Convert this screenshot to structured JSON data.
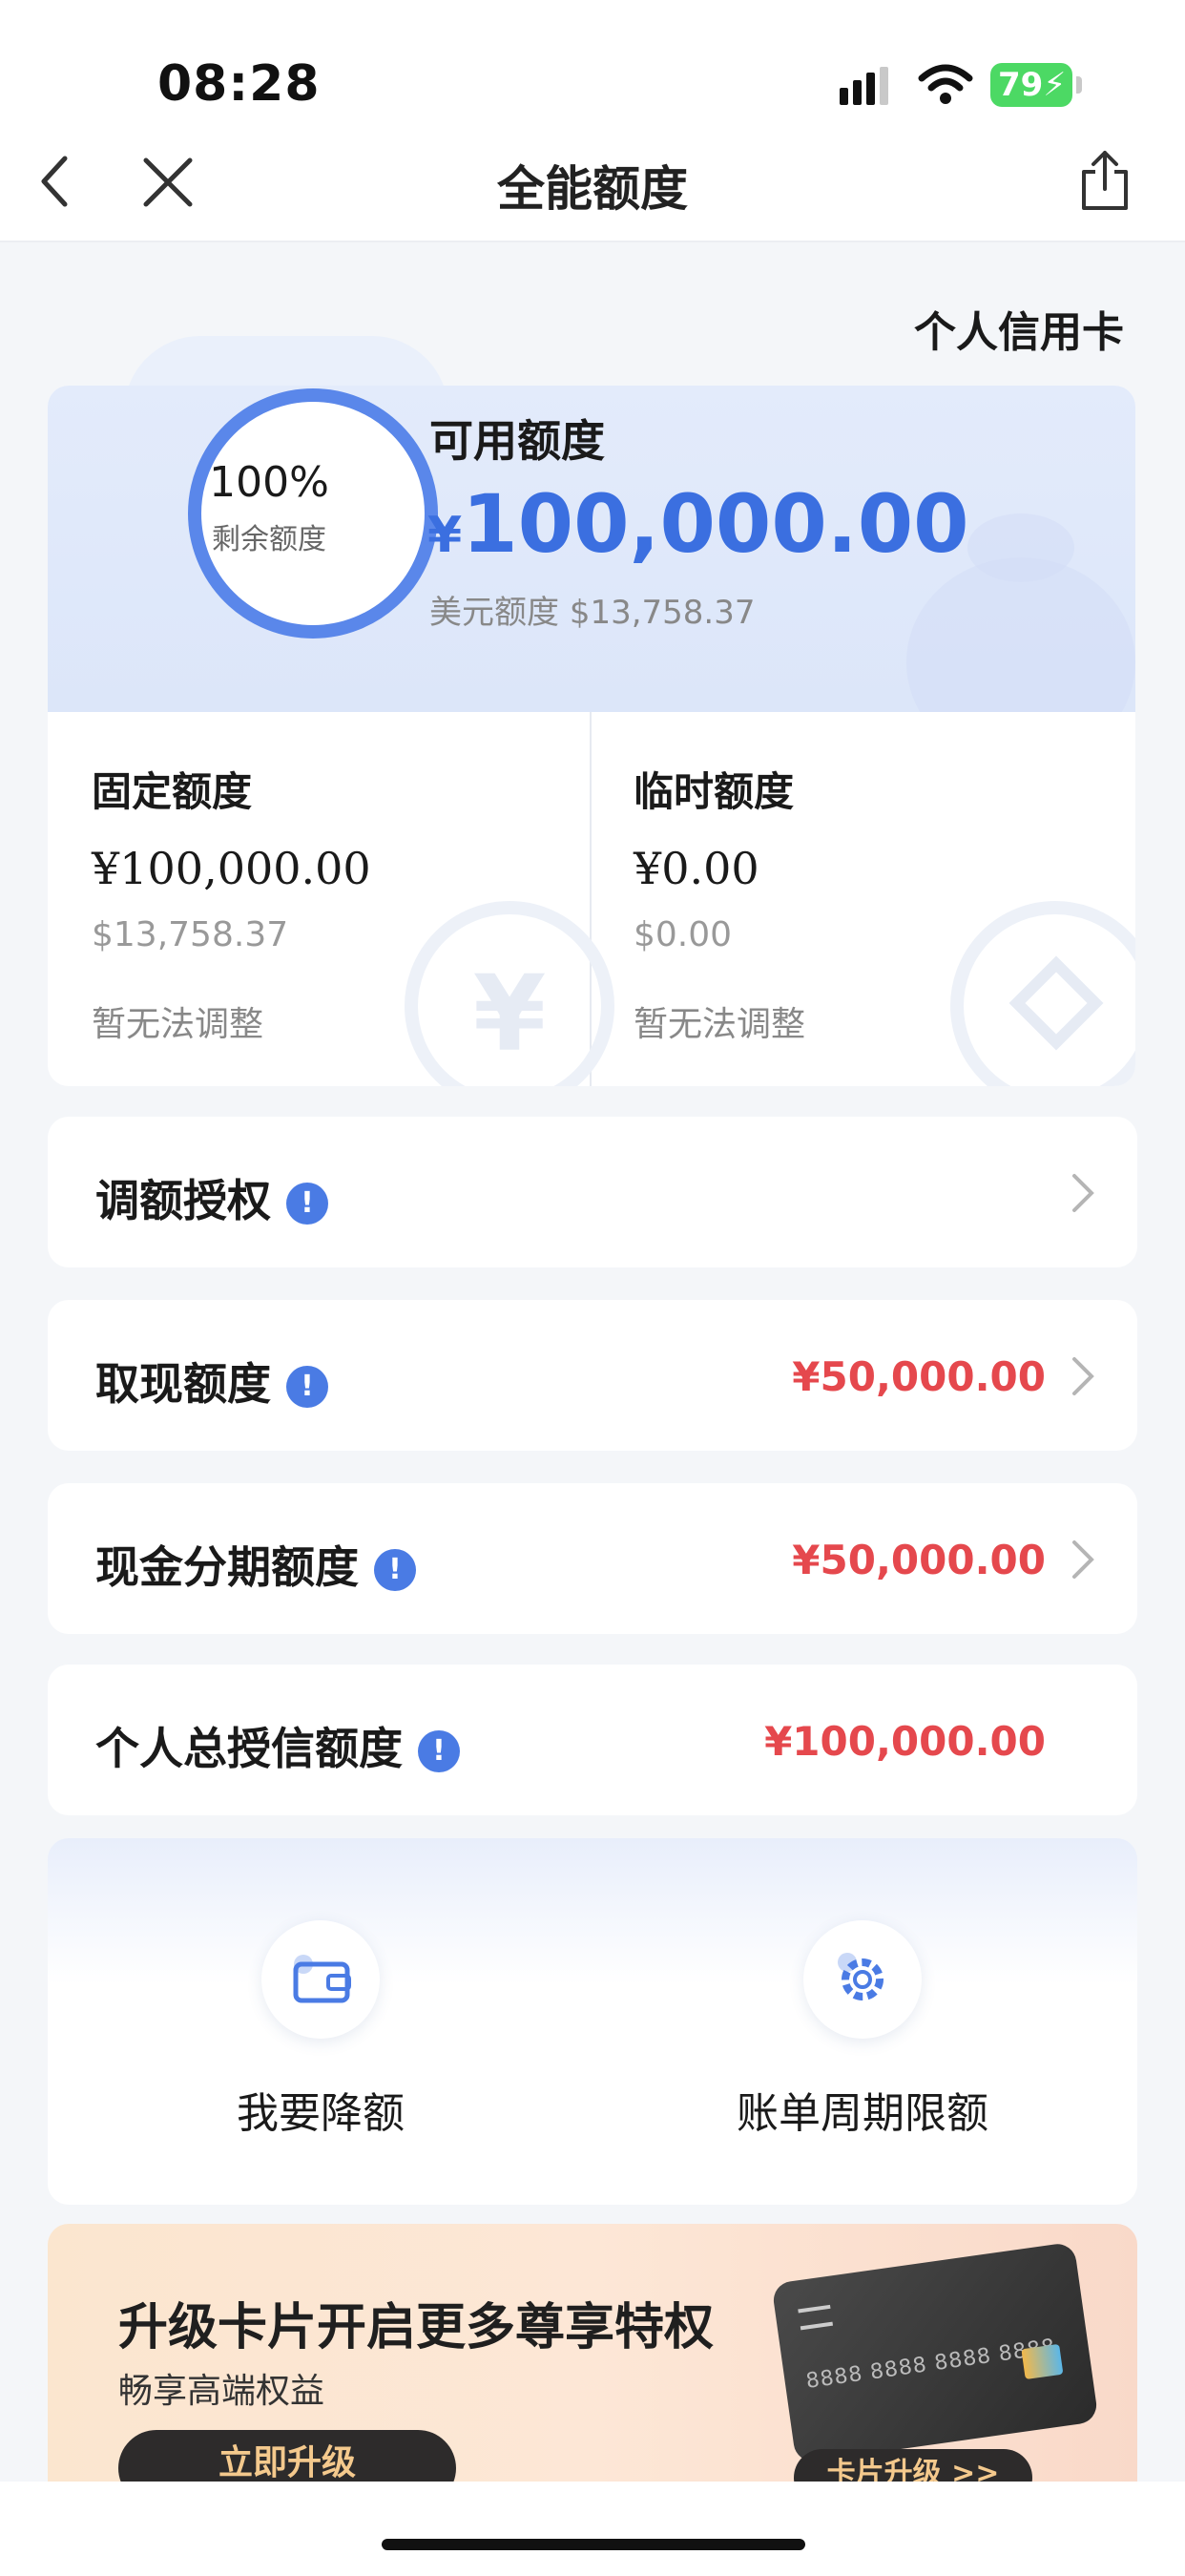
{
  "status_bar": {
    "time": "08:28",
    "battery": "79"
  },
  "nav": {
    "title": "全能额度"
  },
  "card_type": "个人信用卡",
  "quota": {
    "ring_percent": "100%",
    "ring_percent_value": 100,
    "ring_sub": "剩余额度",
    "available_label": "可用额度",
    "available_currency": "¥",
    "available_amount": "100,000.00",
    "usd_label": "美元额度",
    "usd_amount": "$13,758.37",
    "fixed": {
      "label": "固定额度",
      "cny": "¥100,000.00",
      "usd": "$13,758.37",
      "note": "暂无法调整"
    },
    "temp": {
      "label": "临时额度",
      "cny": "¥0.00",
      "usd": "$0.00",
      "note": "暂无法调整"
    }
  },
  "rows": [
    {
      "label": "调额授权",
      "value": ""
    },
    {
      "label": "取现额度",
      "value": "¥50,000.00"
    },
    {
      "label": "现金分期额度",
      "value": "¥50,000.00"
    },
    {
      "label": "个人总授信额度",
      "value": "¥100,000.00"
    }
  ],
  "info_glyph": "!",
  "actions": [
    {
      "label": "我要降额",
      "icon": "wallet-icon"
    },
    {
      "label": "账单周期限额",
      "icon": "gear-icon"
    }
  ],
  "banner": {
    "title": "升级卡片开启更多尊享特权",
    "subtitle": "畅享高端权益",
    "button": "立即升级",
    "card_number": "8888 8888 8888 8888",
    "card_button": "卡片升级 >>"
  },
  "colors": {
    "accent": "#3b6fe0",
    "amount_red": "#e5484d",
    "info_blue": "#4a7be4"
  }
}
